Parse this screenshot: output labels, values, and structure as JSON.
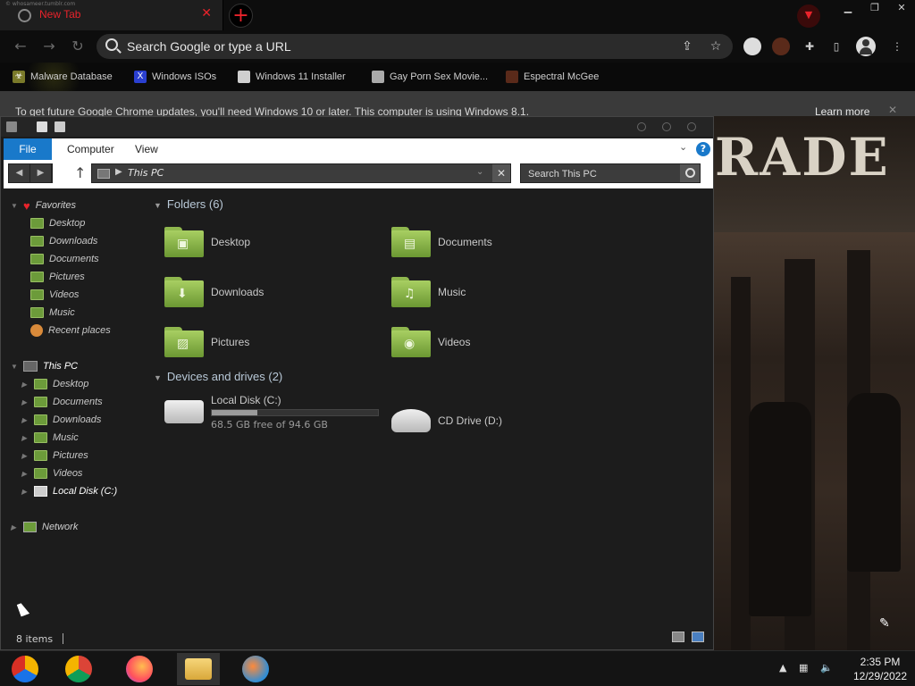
{
  "browser": {
    "tab": {
      "title": "New Tab",
      "ghost_text": "© whosameer.tumblr.com"
    },
    "omnibox": {
      "placeholder": "Search Google or type a URL"
    },
    "bookmarks": [
      {
        "label": "Malware Database",
        "icon": "malware-icon"
      },
      {
        "label": "Windows ISOs",
        "icon": "x-icon"
      },
      {
        "label": "Windows 11 Installer",
        "icon": "installer-icon"
      },
      {
        "label": "Gay Porn Sex Movie...",
        "icon": "site-icon"
      },
      {
        "label": "Espectral McGee",
        "icon": "profile-icon"
      }
    ],
    "infobar": {
      "message": "To get future Google Chrome updates, you'll need Windows 10 or later. This computer is using Windows 8.1.",
      "learn_more": "Learn more"
    }
  },
  "explorer": {
    "ribbon_tabs": [
      "File",
      "Computer",
      "View"
    ],
    "address": {
      "path": "This PC"
    },
    "search": {
      "placeholder": "Search This PC"
    },
    "nav": {
      "favorites_label": "Favorites",
      "favorites": [
        "Desktop",
        "Downloads",
        "Documents",
        "Pictures",
        "Videos",
        "Music",
        "Recent places"
      ],
      "this_pc_label": "This PC",
      "this_pc": [
        "Desktop",
        "Documents",
        "Downloads",
        "Music",
        "Pictures",
        "Videos",
        "Local Disk (C:)"
      ],
      "network_label": "Network"
    },
    "folders_header": "Folders (6)",
    "folders": [
      {
        "name": "Desktop",
        "icon": "desktop-folder-icon"
      },
      {
        "name": "Documents",
        "icon": "documents-folder-icon"
      },
      {
        "name": "Downloads",
        "icon": "downloads-folder-icon"
      },
      {
        "name": "Music",
        "icon": "music-folder-icon"
      },
      {
        "name": "Pictures",
        "icon": "pictures-folder-icon"
      },
      {
        "name": "Videos",
        "icon": "videos-folder-icon"
      }
    ],
    "drives_header": "Devices and drives (2)",
    "drives": [
      {
        "name": "Local Disk (C:)",
        "free_text": "68.5 GB free of 94.6 GB",
        "used_fraction": 0.276
      },
      {
        "name": "CD Drive (D:)"
      }
    ],
    "status": {
      "count": "8 items"
    }
  },
  "taskbar": {
    "time": "2:35 PM",
    "date": "12/29/2022",
    "apps": [
      "chrome-canary-icon",
      "chrome-icon",
      "firefox-icon",
      "file-explorer-icon",
      "people-icon"
    ]
  },
  "colors": {
    "accent": "#1979ca",
    "tab_red": "#e8232b",
    "folder_green": "#8fb74e"
  }
}
